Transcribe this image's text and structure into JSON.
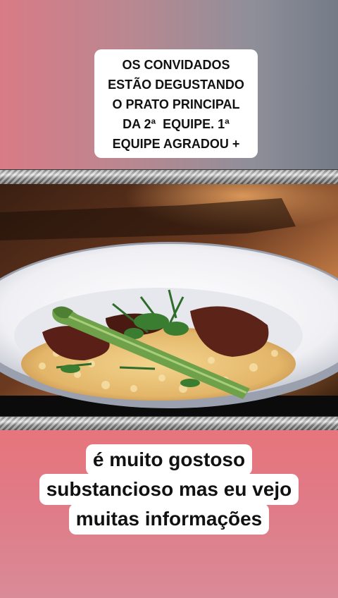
{
  "caption_top": {
    "lines": [
      "OS CONVIDADOS",
      "ESTÃO DEGUSTANDO",
      "O PRATO PRINCIPAL",
      "DA 2ª  EQUIPE. 1ª",
      "EQUIPE AGRADOU +"
    ]
  },
  "caption_bottom": {
    "lines": [
      "é muito gostoso",
      "substancioso mas eu vejo",
      "muitas informações"
    ]
  },
  "colors": {
    "top_background_left": "#d97b86",
    "top_background_right": "#747b87",
    "bottom_background": "#e7757c",
    "caption_box": "#ffffff",
    "caption_text": "#111111"
  },
  "photo": {
    "subject": "risotto-plate-icon"
  }
}
